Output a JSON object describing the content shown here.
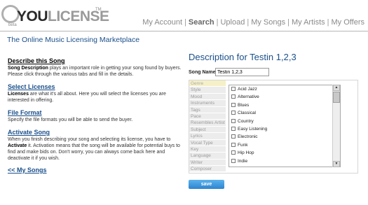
{
  "header": {
    "logo_beta": "beta",
    "logo_you": "YOU",
    "logo_license": "LICENSE",
    "logo_tm": "TM",
    "nav": [
      "My Account",
      "Search",
      "Upload",
      "My Songs",
      "My Artists",
      "My Offers"
    ],
    "nav_active": "Search",
    "tagline": "The Online Music Licensing Marketplace"
  },
  "left": {
    "describe": {
      "title": "Describe this Song",
      "bold": "Song Description",
      "text": " plays an important role in getting your song found by buyers. Please click through the various tabs and fill in the details."
    },
    "licenses": {
      "title": "Select Licenses",
      "bold": "Licenses",
      "text": " are what it's all about. Here you will select the licenses you are interested in offering."
    },
    "file_format": {
      "title": "File Format",
      "text": "Specify the file formats you will be able to send the buyer."
    },
    "activate": {
      "title": "Activate Song",
      "text1": "When you finish describing your song and selecting its license, you have to ",
      "bold": "Activate",
      "text2": " it. Activation means that the song will be available for potential buys to find and make bids on. Don't worry, you can always come back here and deactivate it if you wish."
    },
    "back_link": "<< My Songs"
  },
  "main": {
    "title": "Description for Testin 1,2,3",
    "song_name_label": "Song Name",
    "song_name_value": "Testin 1,2,3",
    "tabs": [
      "Genre",
      "Style",
      "Mood",
      "Instruments",
      "Tags",
      "Pace",
      "Resembles Artist",
      "Subject",
      "Lyrics",
      "Vocal Type",
      "Key",
      "Language",
      "Writer",
      "Composer"
    ],
    "active_tab": "Genre",
    "genres": [
      "Acid Jazz",
      "Alternative",
      "Blues",
      "Classical",
      "Country",
      "Easy Listening",
      "Electronic",
      "Funk",
      "Hip Hop",
      "Indie"
    ],
    "save_label": "save"
  }
}
